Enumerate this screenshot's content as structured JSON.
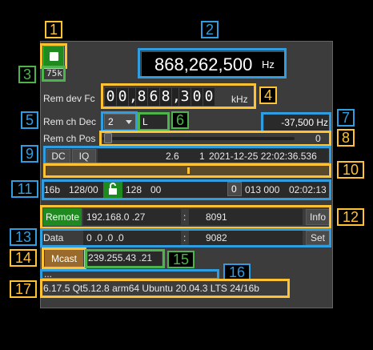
{
  "annotations": [
    "1",
    "2",
    "3",
    "4",
    "5",
    "6",
    "7",
    "8",
    "9",
    "10",
    "11",
    "12",
    "13",
    "14",
    "15",
    "16",
    "17"
  ],
  "header": {
    "center_freq": "868,262,500",
    "freq_unit": "Hz",
    "sample_rate": "75k"
  },
  "rem_dev_fc": {
    "label": "Rem dev Fc",
    "digits": [
      "0",
      "0",
      ",",
      "8",
      "6",
      "8",
      ",",
      "3",
      "0",
      "0"
    ],
    "unit": "kHz"
  },
  "rem_ch_dec": {
    "label": "Rem ch Dec",
    "value": "2",
    "position": "L",
    "offset": "-37,500 Hz"
  },
  "rem_ch_pos": {
    "label": "Rem ch Pos",
    "value": "0"
  },
  "status1": {
    "dc": "DC",
    "iq": "IQ",
    "ratio": "2.6",
    "count": "1",
    "datetime": "2021-12-25  22:02:36.536"
  },
  "status2": {
    "bits": "16b",
    "sizes": "128/00",
    "nb": "128",
    "nb2": "00",
    "unlocked": "0",
    "counters": "013  000",
    "time": "02:02:13"
  },
  "remote": {
    "button": "Remote",
    "address": "192.168.0  .27",
    "sep": ":",
    "port": "8091",
    "info": "Info"
  },
  "data": {
    "label": "Data",
    "address": "0  .0  .0  .0",
    "sep": ":",
    "port": "9082",
    "set": "Set"
  },
  "mcast": {
    "button": "Mcast",
    "address": "239.255.43  .21"
  },
  "status_msg": "...",
  "version": "6.17.5 Qt5.12.8 arm64 Ubuntu 20.04.3 LTS 24/16b",
  "colors": {
    "accent_yellow": "#ffc233",
    "accent_blue": "#2f9de0",
    "accent_green": "#4db34d",
    "remote_green": "#1f8a1f",
    "mcast_brown": "#9a6a2c"
  }
}
